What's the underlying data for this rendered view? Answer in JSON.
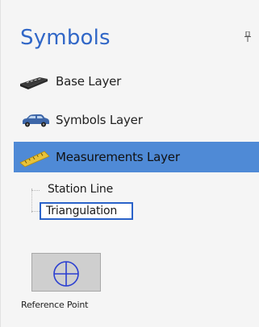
{
  "pane": {
    "title": "Symbols",
    "pin_icon": "pin-icon"
  },
  "layers": [
    {
      "label": "Base Layer",
      "icon": "base-layer-icon",
      "selected": false
    },
    {
      "label": "Symbols Layer",
      "icon": "car-icon",
      "selected": false
    },
    {
      "label": "Measurements Layer",
      "icon": "ruler-icon",
      "selected": true
    }
  ],
  "sub_items": [
    {
      "label": "Station Line",
      "editing": false
    },
    {
      "label": "Triangulation",
      "editing": true
    }
  ],
  "tool": {
    "label": "Reference Point",
    "icon": "crosshair-circle-icon"
  },
  "colors": {
    "title": "#3167c7",
    "selection": "#4f8ad6",
    "edit_border": "#2a62c9",
    "button_bg": "#cfcfcf"
  }
}
